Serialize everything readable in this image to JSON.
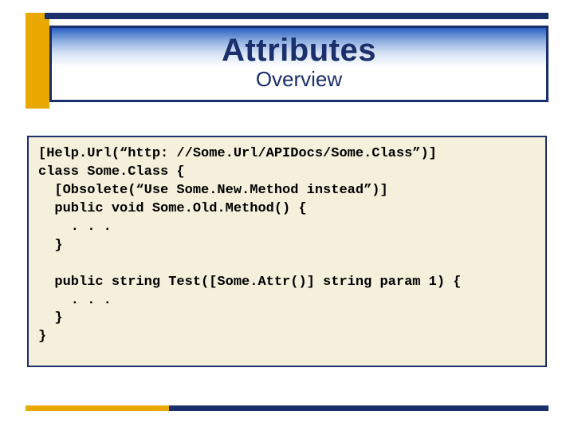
{
  "header": {
    "title": "Attributes",
    "subtitle": "Overview"
  },
  "code": {
    "lines": [
      "[Help.Url(“http: //Some.Url/APIDocs/Some.Class”)]",
      "class Some.Class {",
      "  [Obsolete(“Use Some.New.Method instead”)]",
      "  public void Some.Old.Method() {",
      "    . . .",
      "  }",
      "",
      "  public string Test([Some.Attr()] string param 1) {",
      "    . . .",
      "  }",
      "}"
    ]
  },
  "colors": {
    "navy": "#1a2f6b",
    "gold": "#e8a800",
    "code_bg": "#f4f0dc"
  }
}
